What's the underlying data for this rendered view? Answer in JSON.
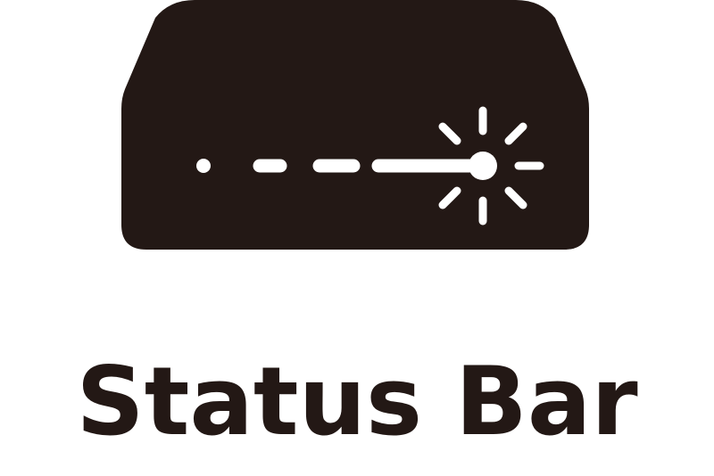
{
  "icon": {
    "name": "status-bar-device-icon",
    "body_color": "#231815",
    "light_color": "#ffffff"
  },
  "caption": {
    "text": "Status Bar"
  }
}
